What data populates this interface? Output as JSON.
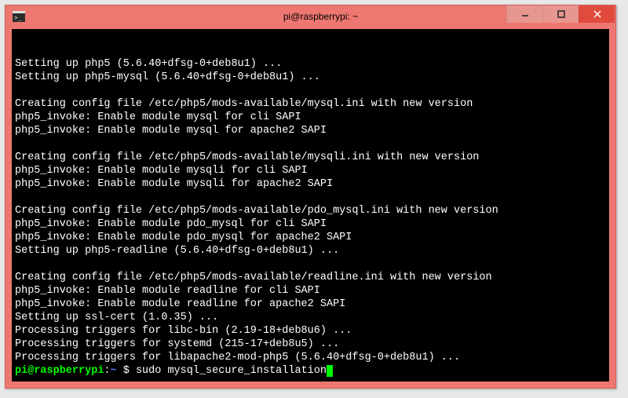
{
  "window": {
    "title": "pi@raspberrypi: ~"
  },
  "terminal": {
    "lines": [
      "Setting up php5 (5.6.40+dfsg-0+deb8u1) ...",
      "Setting up php5-mysql (5.6.40+dfsg-0+deb8u1) ...",
      "",
      "Creating config file /etc/php5/mods-available/mysql.ini with new version",
      "php5_invoke: Enable module mysql for cli SAPI",
      "php5_invoke: Enable module mysql for apache2 SAPI",
      "",
      "Creating config file /etc/php5/mods-available/mysqli.ini with new version",
      "php5_invoke: Enable module mysqli for cli SAPI",
      "php5_invoke: Enable module mysqli for apache2 SAPI",
      "",
      "Creating config file /etc/php5/mods-available/pdo_mysql.ini with new version",
      "php5_invoke: Enable module pdo_mysql for cli SAPI",
      "php5_invoke: Enable module pdo_mysql for apache2 SAPI",
      "Setting up php5-readline (5.6.40+dfsg-0+deb8u1) ...",
      "",
      "Creating config file /etc/php5/mods-available/readline.ini with new version",
      "php5_invoke: Enable module readline for cli SAPI",
      "php5_invoke: Enable module readline for apache2 SAPI",
      "Setting up ssl-cert (1.0.35) ...",
      "Processing triggers for libc-bin (2.19-18+deb8u6) ...",
      "Processing triggers for systemd (215-17+deb8u5) ...",
      "Processing triggers for libapache2-mod-php5 (5.6.40+dfsg-0+deb8u1) ..."
    ],
    "prompt": {
      "user_host": "pi@raspberrypi",
      "separator": ":",
      "path": "~ ",
      "symbol": "$ ",
      "command": "sudo mysql_secure_installation"
    }
  }
}
